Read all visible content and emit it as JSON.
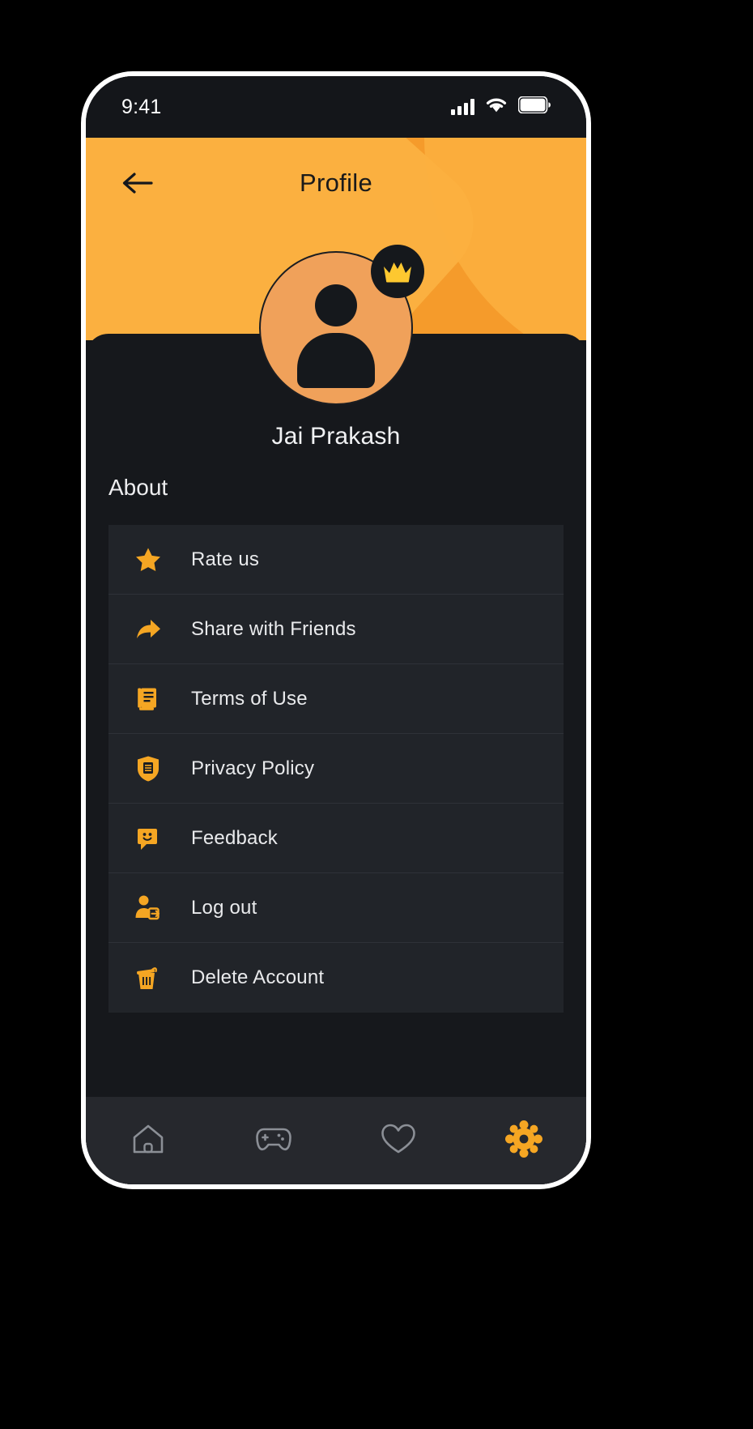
{
  "status_bar": {
    "time": "9:41",
    "signal_icon": "signal-bars-icon",
    "wifi_icon": "wifi-icon",
    "battery_icon": "battery-full-icon"
  },
  "header": {
    "title": "Profile",
    "back_icon": "arrow-left-icon",
    "bg_color": "#f59b2b",
    "bg_accent_color": "#fbb040"
  },
  "profile": {
    "name": "Jai Prakash",
    "avatar_icon": "user-avatar-icon",
    "badge_icon": "crown-icon",
    "avatar_bg": "#f0a15a"
  },
  "about": {
    "section_title": "About",
    "items": [
      {
        "label": "Rate us",
        "icon": "star-icon"
      },
      {
        "label": "Share with Friends",
        "icon": "share-arrow-icon"
      },
      {
        "label": "Terms of Use",
        "icon": "document-list-icon"
      },
      {
        "label": "Privacy Policy",
        "icon": "shield-document-icon"
      },
      {
        "label": "Feedback",
        "icon": "chat-smile-icon"
      },
      {
        "label": "Log out",
        "icon": "logout-user-icon"
      },
      {
        "label": "Delete Account",
        "icon": "trash-icon"
      }
    ],
    "icon_color": "#f5a623",
    "row_bg": "#212429",
    "divider_color": "#2e3138"
  },
  "bottom_nav": {
    "active_color": "#f5a623",
    "inactive_color": "#8b8f96",
    "items": [
      {
        "name": "home",
        "icon": "home-icon",
        "active": false
      },
      {
        "name": "games",
        "icon": "gamepad-icon",
        "active": false
      },
      {
        "name": "favorites",
        "icon": "heart-icon",
        "active": false
      },
      {
        "name": "settings",
        "icon": "gear-icon",
        "active": true
      }
    ]
  }
}
